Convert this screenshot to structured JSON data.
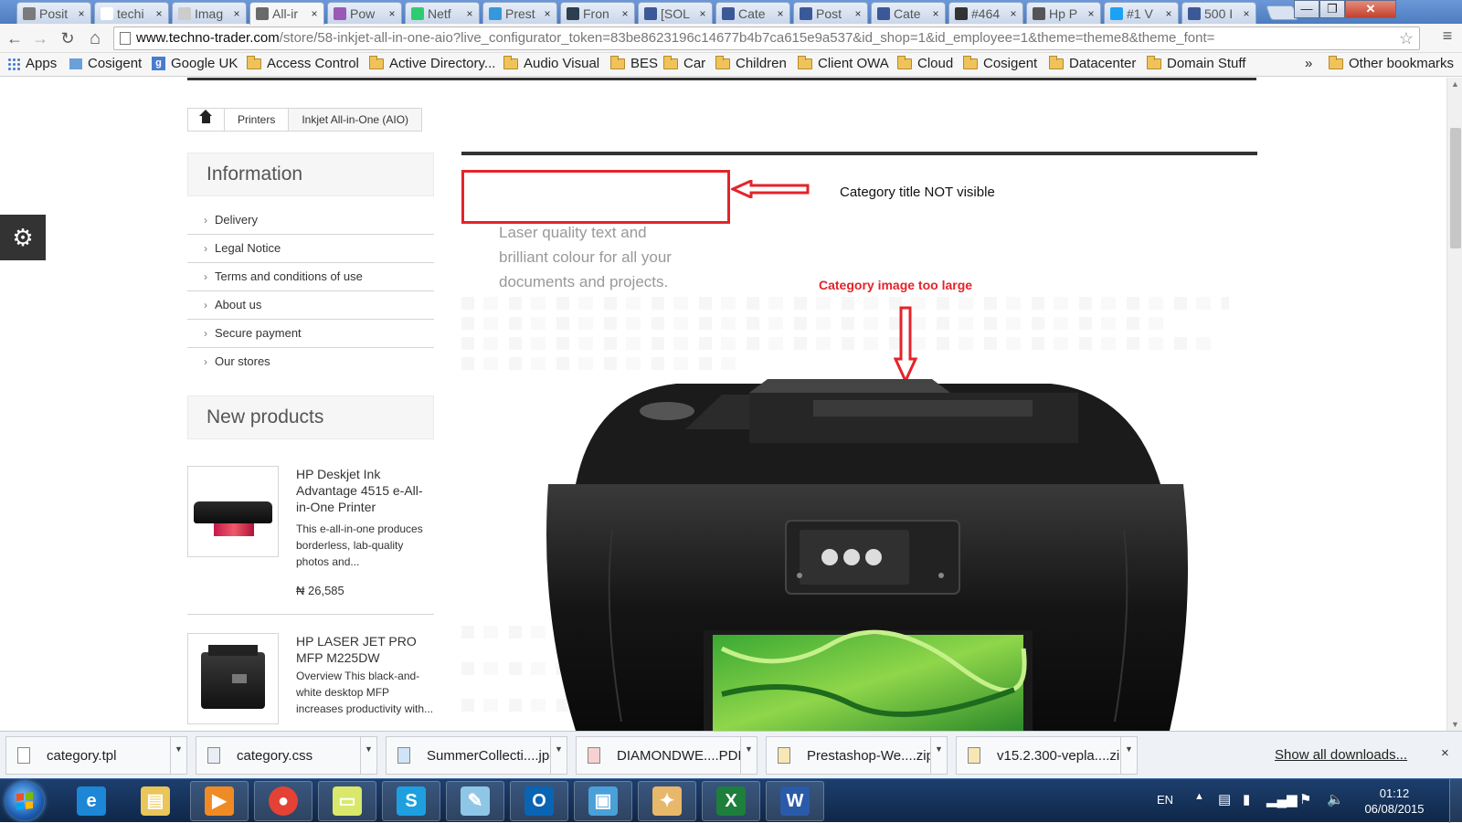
{
  "tabs": [
    {
      "label": "Posit",
      "color": "#7a7a7a"
    },
    {
      "label": "techi",
      "color": "#ffffff"
    },
    {
      "label": "Imag",
      "color": "#cccccc"
    },
    {
      "label": "All-ir",
      "color": "#6a6a6a",
      "active": true
    },
    {
      "label": "Pow",
      "color": "#9b59b6"
    },
    {
      "label": "Netf",
      "color": "#2ecc71"
    },
    {
      "label": "Prest",
      "color": "#3498db"
    },
    {
      "label": "Fron",
      "color": "#2c3e50"
    },
    {
      "label": "[SOL",
      "color": "#3b5998"
    },
    {
      "label": "Cate",
      "color": "#3b5998"
    },
    {
      "label": "Post",
      "color": "#3b5998"
    },
    {
      "label": "Cate",
      "color": "#3b5998"
    },
    {
      "label": "#464",
      "color": "#333333"
    },
    {
      "label": "Hp P",
      "color": "#555555"
    },
    {
      "label": "#1 V",
      "color": "#1da1f2"
    },
    {
      "label": "500 I",
      "color": "#3b5998"
    }
  ],
  "close_glyph": "×",
  "window": {
    "minimize": "—",
    "restore": "❐",
    "close": "✕"
  },
  "toolbar": {
    "back": "←",
    "forward": "→",
    "reload": "↻",
    "home": "⌂",
    "url_domain": "www.techno-trader.com",
    "url_path": "/store/58-inkjet-all-in-one-aio?live_configurator_token=83be8623196c14677b4b7ca615e9a537&id_shop=1&id_employee=1&theme=theme8&theme_font=",
    "star": "☆",
    "menu": "≡"
  },
  "bookmarks": [
    {
      "label": "Apps",
      "icon": "apps-icon"
    },
    {
      "label": "Cosigent",
      "icon": "page-icon"
    },
    {
      "label": "Google UK",
      "icon": "google-icon"
    },
    {
      "label": "Access Control",
      "icon": "folder-icon"
    },
    {
      "label": "Active Directory...",
      "icon": "folder-icon"
    },
    {
      "label": "Audio Visual",
      "icon": "folder-icon"
    },
    {
      "label": "BES",
      "icon": "folder-icon"
    },
    {
      "label": "Car",
      "icon": "folder-icon"
    },
    {
      "label": "Children",
      "icon": "folder-icon"
    },
    {
      "label": "Client OWA",
      "icon": "folder-icon"
    },
    {
      "label": "Cloud",
      "icon": "folder-icon"
    },
    {
      "label": "Cosigent",
      "icon": "folder-icon"
    },
    {
      "label": "Datacenter",
      "icon": "folder-icon"
    },
    {
      "label": "Domain Stuff",
      "icon": "folder-icon"
    }
  ],
  "bookmarks_overflow": "»",
  "other_bookmarks": "Other bookmarks",
  "breadcrumb": {
    "items": [
      "Printers",
      "Inkjet All-in-One (AIO)"
    ]
  },
  "sidebar": {
    "info_title": "Information",
    "info_items": [
      "Delivery",
      "Legal Notice",
      "Terms and conditions of use",
      "About us",
      "Secure payment",
      "Our stores"
    ],
    "chevron": "›",
    "new_title": "New products",
    "products": [
      {
        "name": "HP Deskjet Ink Advantage 4515 e-All-in-One Printer",
        "desc": "This e-all-in-one produces borderless, lab-quality photos and...",
        "price": "₦ 26,585"
      },
      {
        "name": "HP LASER JET PRO MFP M225DW",
        "desc": "Overview This black-and-white desktop MFP increases productivity with..."
      }
    ]
  },
  "gear": "⚙",
  "main": {
    "description": "Laser quality text and brilliant colour for all your documents and projects.",
    "annotation_title": "Category title NOT visible",
    "annotation_image": "Category image too large",
    "annotation_color": "#e4232a"
  },
  "downloads": [
    {
      "name": "category.tpl"
    },
    {
      "name": "category.css"
    },
    {
      "name": "SummerCollecti....jpg"
    },
    {
      "name": "DIAMONDWE....PDF"
    },
    {
      "name": "Prestashop-We....zip"
    },
    {
      "name": "v15.2.300-vepla....zip"
    }
  ],
  "show_all": "Show all downloads...",
  "downloads_close": "×",
  "taskbar": {
    "apps": [
      "internet-explorer",
      "file-explorer",
      "media-player",
      "chrome",
      "sticky-notes",
      "skype",
      "notepad",
      "outlook",
      "remote-desktop",
      "paint",
      "excel",
      "word"
    ],
    "lang": "EN",
    "time": "01:12",
    "date": "06/08/2015"
  }
}
